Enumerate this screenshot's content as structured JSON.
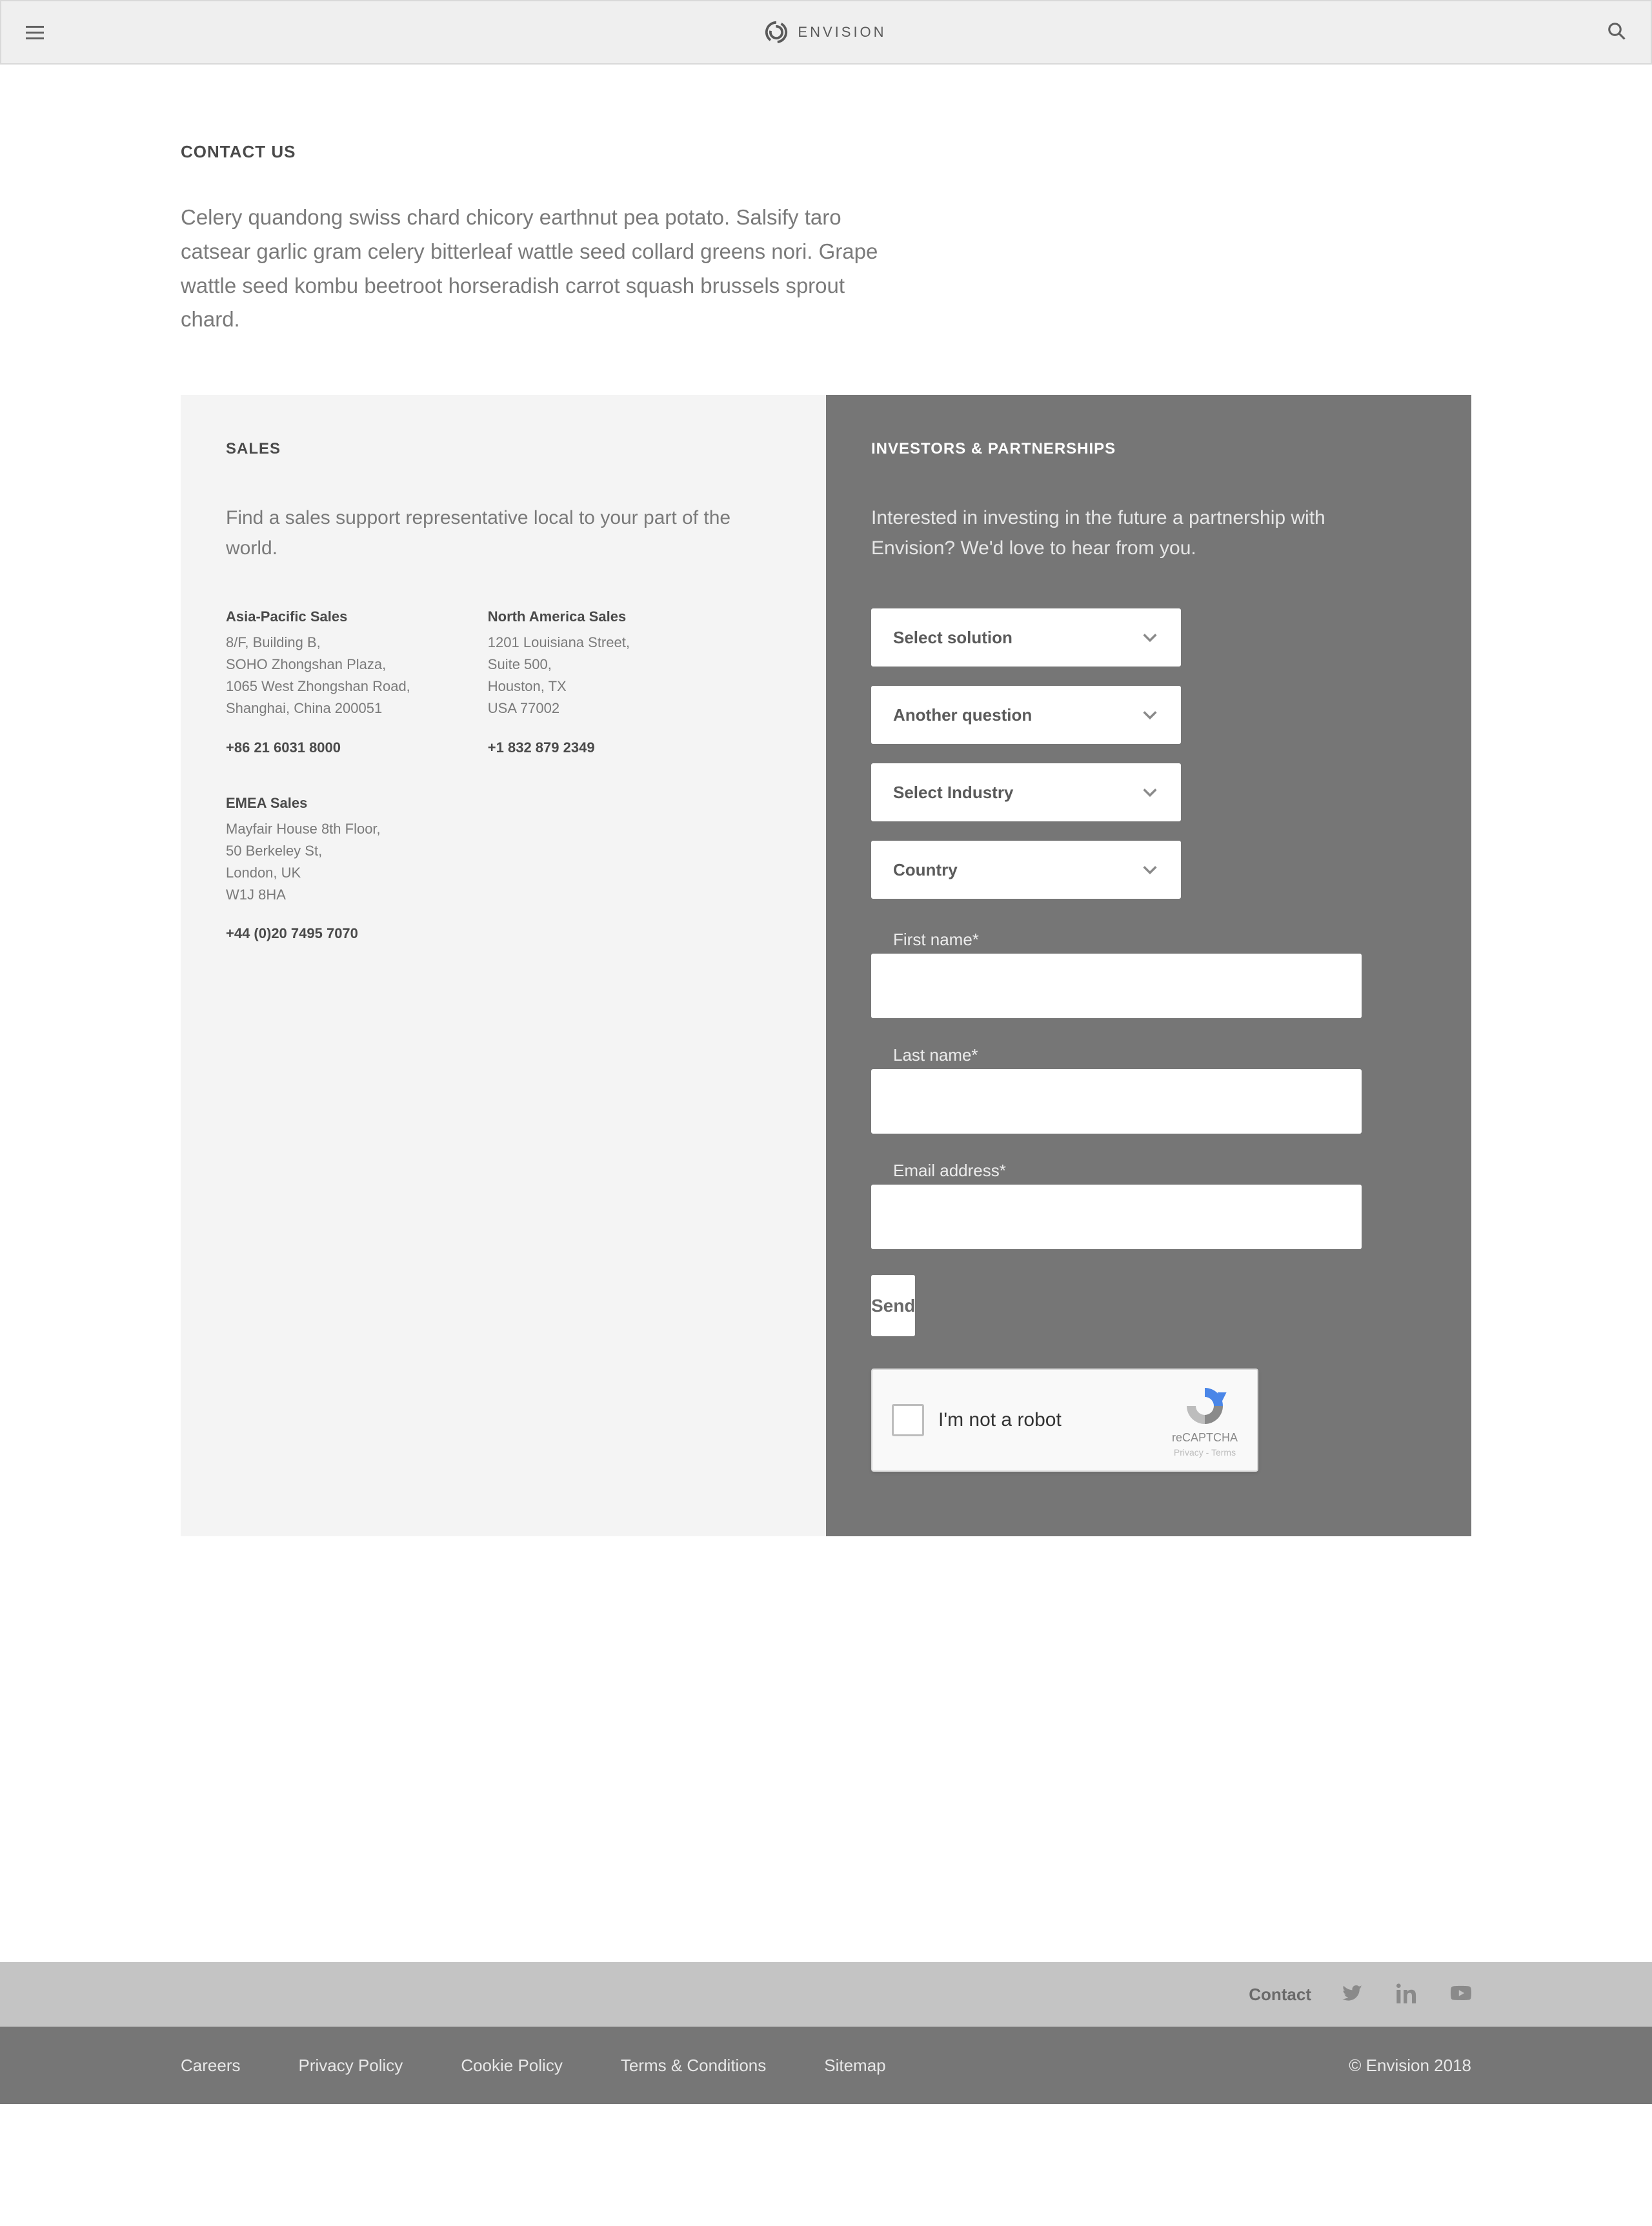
{
  "header": {
    "brand": "ENVISION"
  },
  "intro": {
    "title": "CONTACT US",
    "body": "Celery quandong swiss chard chicory earthnut pea potato. Salsify taro catsear garlic gram celery bitterleaf wattle seed collard greens nori. Grape wattle seed kombu beetroot horseradish carrot squash brussels sprout chard."
  },
  "sales": {
    "title": "SALES",
    "sub": "Find a sales support representative local to your part of the world.",
    "asia": {
      "title": "Asia-Pacific Sales",
      "l1": "8/F, Building B,",
      "l2": "SOHO Zhongshan Plaza,",
      "l3": "1065 West Zhongshan Road,",
      "l4": "Shanghai, China 200051",
      "phone": "+86 21 6031 8000"
    },
    "na": {
      "title": "North America Sales",
      "l1": "1201 Louisiana Street,",
      "l2": "Suite 500,",
      "l3": "Houston, TX",
      "l4": "USA 77002",
      "phone": "+1 832 879 2349"
    },
    "emea": {
      "title": "EMEA Sales",
      "l1": "Mayfair House 8th Floor,",
      "l2": "50 Berkeley St,",
      "l3": "London, UK",
      "l4": "W1J 8HA",
      "phone": "+44 (0)20 7495 7070"
    }
  },
  "investors": {
    "title": "INVESTORS & PARTNERSHIPS",
    "sub": "Interested in investing in the future a partnership with Envision? We'd love to hear from you.",
    "select1": "Select solution",
    "select2": "Another question",
    "select3": "Select Industry",
    "select4": "Country",
    "label_first": "First name*",
    "label_last": "Last name*",
    "label_email": "Email address*",
    "send": "Send",
    "recaptcha_text": "I'm not a robot",
    "recaptcha_brand": "reCAPTCHA",
    "recaptcha_legal": "Privacy - Terms"
  },
  "footer_upper": {
    "contact": "Contact"
  },
  "footer_lower": {
    "careers": "Careers",
    "privacy": "Privacy Policy",
    "cookie": "Cookie Policy",
    "terms": "Terms & Conditions",
    "sitemap": "Sitemap",
    "copyright": "© Envision 2018"
  }
}
